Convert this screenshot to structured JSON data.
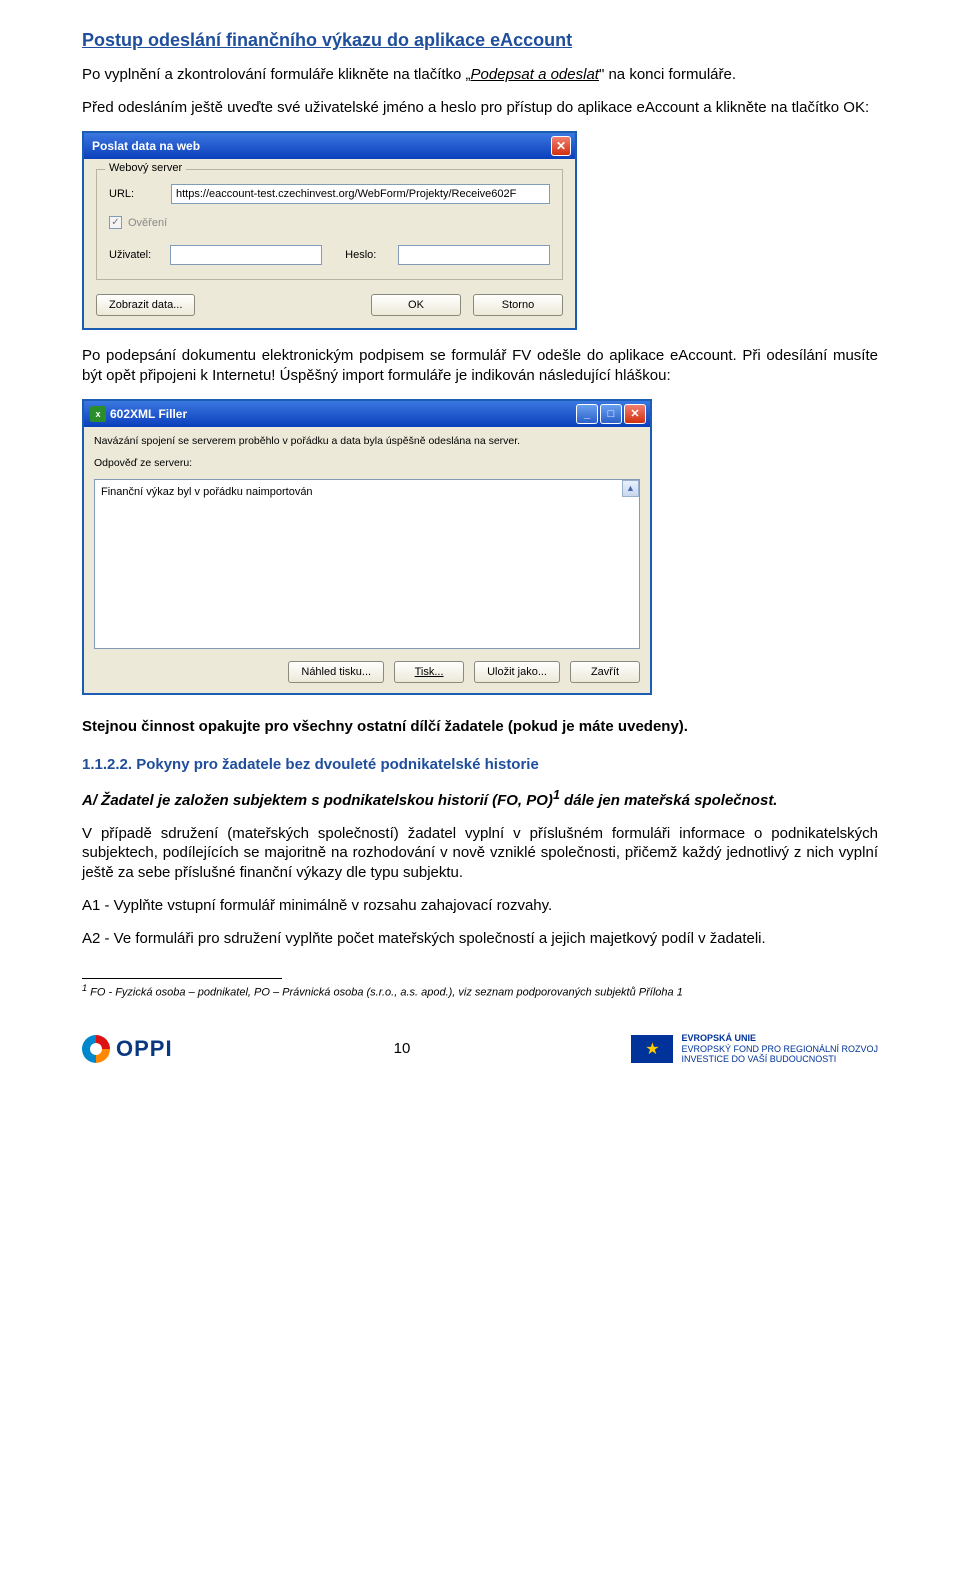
{
  "heading1": "Postup odeslání finančního výkazu do aplikace eAccount",
  "p1_a": "Po vyplnění a zkontrolování formuláře klikněte na tlačítko „",
  "p1_b": "Podepsat a odeslat",
  "p1_c": "\" na konci formuláře.",
  "p2": "Před odesláním ještě uveďte své uživatelské jméno a heslo pro přístup do aplikace eAccount a klikněte na tlačítko OK:",
  "dlg1": {
    "title": "Poslat data na web",
    "legend": "Webový server",
    "url_label": "URL:",
    "url_value": "https://eaccount-test.czechinvest.org/WebForm/Projekty/Receive602F",
    "verify_label": "Ověření",
    "verify_checked": true,
    "user_label": "Uživatel:",
    "user_value": "",
    "pass_label": "Heslo:",
    "pass_value": "",
    "btn_show": "Zobrazit data...",
    "btn_ok": "OK",
    "btn_cancel": "Storno"
  },
  "p3": "Po podepsání dokumentu elektronickým podpisem se formulář FV odešle do aplikace eAccount. Při odesílání musíte být opět připojeni k Internetu! Úspěšný import formuláře je indikován následující hláškou:",
  "dlg2": {
    "title": "602XML Filler",
    "msg1": "Navázání spojení se serverem proběhlo v pořádku a data byla úspěšně odeslána na server.",
    "msg2_label": "Odpověď ze serveru:",
    "response": "Finanční výkaz byl v pořádku naimportován",
    "btn_preview": "Náhled tisku...",
    "btn_print": "Tisk...",
    "btn_saveas": "Uložit jako...",
    "btn_close": "Zavřít"
  },
  "p4": "Stejnou činnost opakujte pro všechny ostatní dílčí žadatele (pokud je máte uvedeny).",
  "heading2": "1.1.2.2. Pokyny pro žadatele bez dvouleté podnikatelské historie",
  "p5_a": "A/ Žadatel je založen subjektem s podnikatelskou historií (FO, PO)",
  "p5_sup": "1",
  "p5_b": " dále jen mateřská společnost.",
  "p6": "V případě sdružení (mateřských společností) žadatel vyplní v příslušném formuláři informace o podnikatelských subjektech, podílejících se majoritně na rozhodování v nově vzniklé společnosti, přičemž každý jednotlivý z nich vyplní ještě za sebe příslušné finanční výkazy dle typu subjektu.",
  "p7": "A1 - Vyplňte vstupní formulář minimálně v rozsahu zahajovací rozvahy.",
  "p8": "A2 - Ve formuláři pro sdružení vyplňte počet mateřských společností a jejich majetkový podíl v žadateli.",
  "footnote_num": "1",
  "footnote": " FO  - Fyzická osoba – podnikatel, PO – Právnická osoba (s.r.o., a.s. apod.), viz seznam podporovaných subjektů Příloha 1",
  "footer": {
    "oppi": "OPPI",
    "pagenum": "10",
    "eu_line1": "EVROPSKÁ UNIE",
    "eu_line2": "EVROPSKÝ FOND PRO REGIONÁLNÍ ROZVOJ",
    "eu_line3": "INVESTICE DO VAŠÍ BUDOUCNOSTI"
  }
}
